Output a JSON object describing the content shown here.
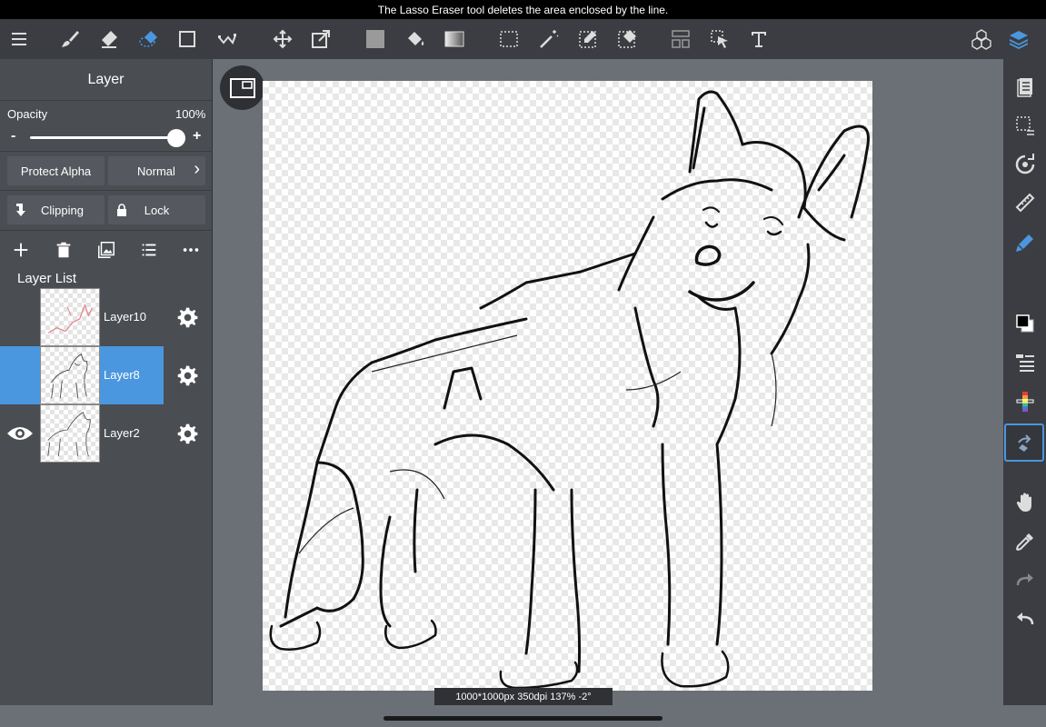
{
  "status_bar": {
    "message": "The Lasso Eraser tool deletes the area enclosed by the line."
  },
  "toolbar": {
    "icons": [
      "menu-icon",
      "brush-icon",
      "eraser-icon",
      "lasso-eraser-icon",
      "rectangle-icon",
      "pen-vector-icon",
      "move-icon",
      "transform-icon",
      "fill-color-icon",
      "bucket-icon",
      "gradient-icon",
      "select-rect-icon",
      "magic-wand-icon",
      "select-pen-icon",
      "select-eraser-icon",
      "layout-icon",
      "select-move-icon",
      "text-icon",
      "materials-icon",
      "layers-icon"
    ],
    "accent": "#4b97df"
  },
  "layer_panel": {
    "title": "Layer",
    "opacity_label": "Opacity",
    "opacity_value": "100%",
    "opacity_level": 1.0,
    "minus": "-",
    "plus": "+",
    "protect_alpha": "Protect Alpha",
    "blend_mode": "Normal",
    "chevron": "›",
    "clipping": "Clipping",
    "lock": "Lock",
    "layer_list_label": "Layer List",
    "layers": [
      {
        "name": "Layer10",
        "selected": false,
        "visible": false
      },
      {
        "name": "Layer8",
        "selected": true,
        "visible": false
      },
      {
        "name": "Layer2",
        "selected": false,
        "visible": true
      }
    ]
  },
  "canvas": {
    "info": "1000*1000px 350dpi 137% -2°"
  },
  "right_bar": {
    "icons": [
      "page-icon",
      "selection-icon",
      "rotate-icon",
      "ruler-icon",
      "pen-fill-icon",
      "color-swatch-icon",
      "brush-list-icon",
      "color-palette-icon",
      "lasso-eraser-active-icon",
      "hand-icon",
      "eyedropper-icon",
      "redo-icon",
      "undo-icon"
    ]
  }
}
